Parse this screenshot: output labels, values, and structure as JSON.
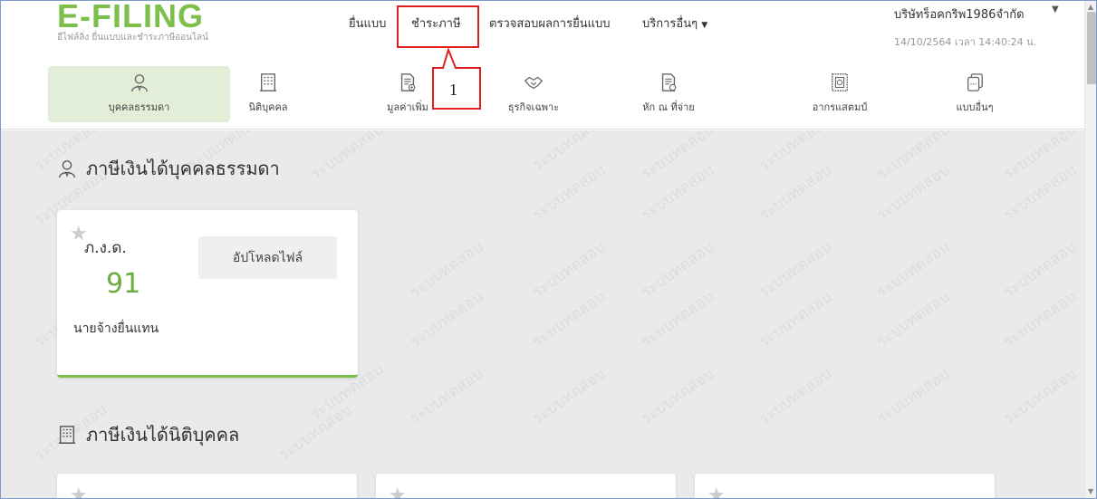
{
  "header": {
    "logo": "E-FILING",
    "logo_subtitle": "อีไฟล์ลิ่ง ยื่นแบบและชำระภาษีออนไลน์",
    "nav": [
      {
        "label": "ยื่นแบบ"
      },
      {
        "label": "ชำระภาษี"
      },
      {
        "label": "ตรวจสอบผลการยื่นแบบ"
      },
      {
        "label": "บริการอื่นๆ"
      }
    ],
    "user_name": "บริษัทร็อคกริพ1986จำกัด",
    "datetime": "14/10/2564 เวลา 14:40:24 น.",
    "callout_number": "1"
  },
  "categories": [
    {
      "label": "บุคคลธรรมดา",
      "icon": "person-icon",
      "active": true
    },
    {
      "label": "นิติบุคคล",
      "icon": "building-icon",
      "active": false
    },
    {
      "label": "มูลค่าเพิ่ม",
      "icon": "document-plus-icon",
      "active": false
    },
    {
      "label": "ธุรกิจเฉพาะ",
      "icon": "handshake-icon",
      "active": false
    },
    {
      "label": "หัก ณ ที่จ่าย",
      "icon": "document-check-icon",
      "active": false
    },
    {
      "label": "อากรแสตมป์",
      "icon": "stamp-icon",
      "active": false
    },
    {
      "label": "แบบอื่นๆ",
      "icon": "documents-icon",
      "active": false
    }
  ],
  "main": {
    "watermark": "ระบบทดสอบ",
    "section1_title": "ภาษีเงินได้บุคคลธรรมดา",
    "section2_title": "ภาษีเงินได้นิติบุคคล",
    "card": {
      "form_name": "ภ.ง.ด.",
      "form_number": "91",
      "description": "นายจ้างยื่นแทน",
      "upload_label": "อัปโหลดไฟล์"
    }
  },
  "colors": {
    "brand_green": "#7cbf4a",
    "active_tab_bg": "#e3eed9",
    "callout_red": "#e02020"
  }
}
